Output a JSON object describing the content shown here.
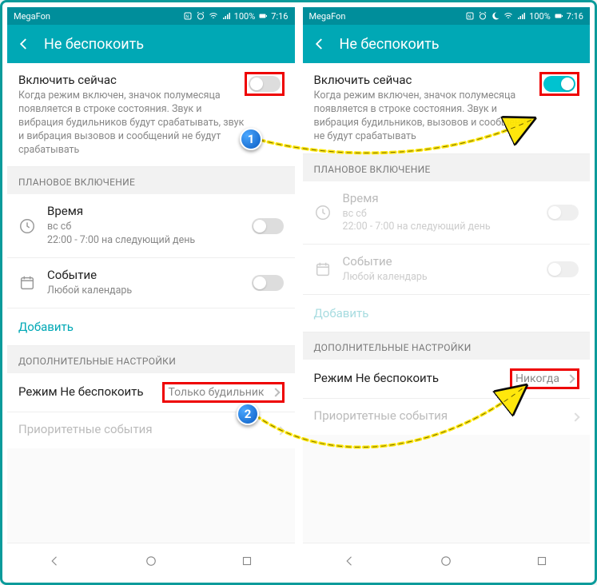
{
  "statusbar": {
    "carrier": "MegaFon",
    "battery": "100%",
    "time": "7:16"
  },
  "header": {
    "title": "Не беспокоить"
  },
  "left": {
    "enable_title": "Включить сейчас",
    "enable_desc": "Когда режим включен, значок полумесяца появляется в строке состояния. Звук и вибрация будильников будут срабатывать, звук и вибрация вызовов и сообщений не будут срабатывать",
    "section_schedule": "ПЛАНОВОЕ ВКЛЮЧЕНИЕ",
    "time_title": "Время",
    "time_sub1": "вс сб",
    "time_sub2": "22:00 - 7:00 на следующий день",
    "event_title": "Событие",
    "event_sub": "Любой календарь",
    "add": "Добавить",
    "section_extra": "ДОПОЛНИТЕЛЬНЫЕ НАСТРОЙКИ",
    "dnd_mode_label": "Режим Не беспокоить",
    "dnd_mode_value": "Только будильник",
    "priority": "Приоритетные события"
  },
  "right": {
    "enable_title": "Включить сейчас",
    "enable_desc": "Когда режим включен, значок полумесяца появляется в строке состояния. Звук и вибрация будильников, вызовов и сообщений не будут срабатывать",
    "section_schedule": "ПЛАНОВОЕ ВКЛЮЧЕНИЕ",
    "time_title": "Время",
    "time_sub1": "вс сб",
    "time_sub2": "22:00 - 7:00 на следующий день",
    "event_title": "Событие",
    "event_sub": "Любой календарь",
    "add": "Добавить",
    "section_extra": "ДОПОЛНИТЕЛЬНЫЕ НАСТРОЙКИ",
    "dnd_mode_label": "Режим Не беспокоить",
    "dnd_mode_value": "Никогда",
    "priority": "Приоритетные события"
  },
  "markers": {
    "m1": "1",
    "m2": "2"
  }
}
